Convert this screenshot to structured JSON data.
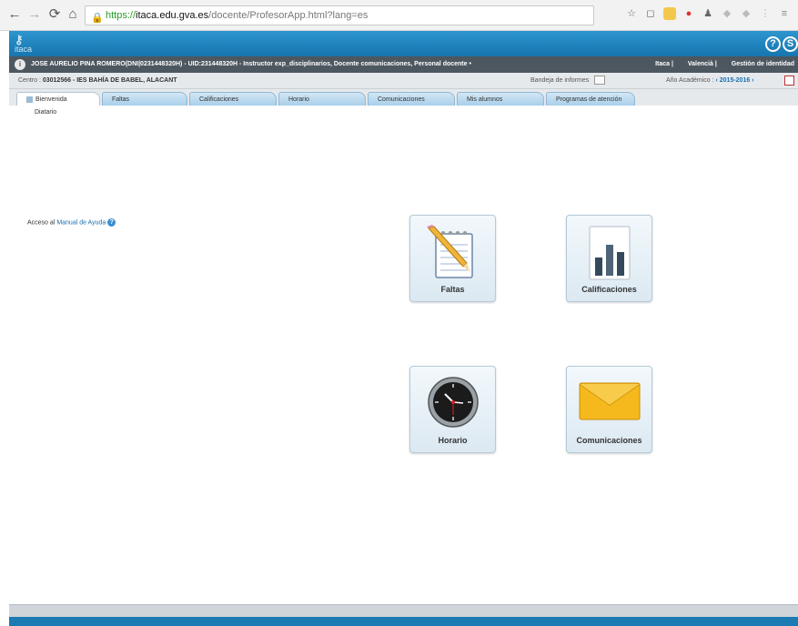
{
  "browser": {
    "url_protocol": "https://",
    "url_host": "itaca.edu.gva.es",
    "url_path": "/docente/ProfesorApp.html?lang=es"
  },
  "app": {
    "logo": "itaca",
    "help_icons": [
      "?",
      "S"
    ]
  },
  "user_bar": {
    "user_text": "JOSE AURELIO PINA ROMERO(DNI|0231448320H) - UID:231448320H - Instructor exp_disciplinarios, Docente comunicaciones, Personal docente •",
    "right_items": [
      "Itaca  |",
      "Valencià  |",
      "Gestión de identidad"
    ]
  },
  "centro_bar": {
    "centro_label": "Centro :",
    "centro_value": "03012566 - IES BAHÍA DE BABEL, ALACANT",
    "bandeja_label": "Bandeja de informes",
    "anio_label": "Año Académico :",
    "anio_value": "‹ 2015-2016 ›"
  },
  "tabs": [
    {
      "label": "Bienvenida",
      "active": true
    },
    {
      "label": "Faltas",
      "active": false
    },
    {
      "label": "Calificaciones",
      "active": false
    },
    {
      "label": "Horario",
      "active": false
    },
    {
      "label": "Comunicaciones",
      "active": false
    },
    {
      "label": "Mis alumnos",
      "active": false
    },
    {
      "label": "Programas de atención",
      "active": false
    }
  ],
  "content": {
    "subtab": "Diatario",
    "manual_prefix": "Acceso al",
    "manual_link": "Manual de Ayuda"
  },
  "tiles": [
    {
      "label": "Faltas",
      "icon": "notepad-pencil-icon"
    },
    {
      "label": "Calificaciones",
      "icon": "bar-chart-icon"
    },
    {
      "label": "Horario",
      "icon": "clock-icon"
    },
    {
      "label": "Comunicaciones",
      "icon": "envelope-icon"
    }
  ],
  "colors": {
    "header_blue": "#1c7bb3",
    "user_bar": "#4d5760",
    "link": "#1a6fb0"
  }
}
